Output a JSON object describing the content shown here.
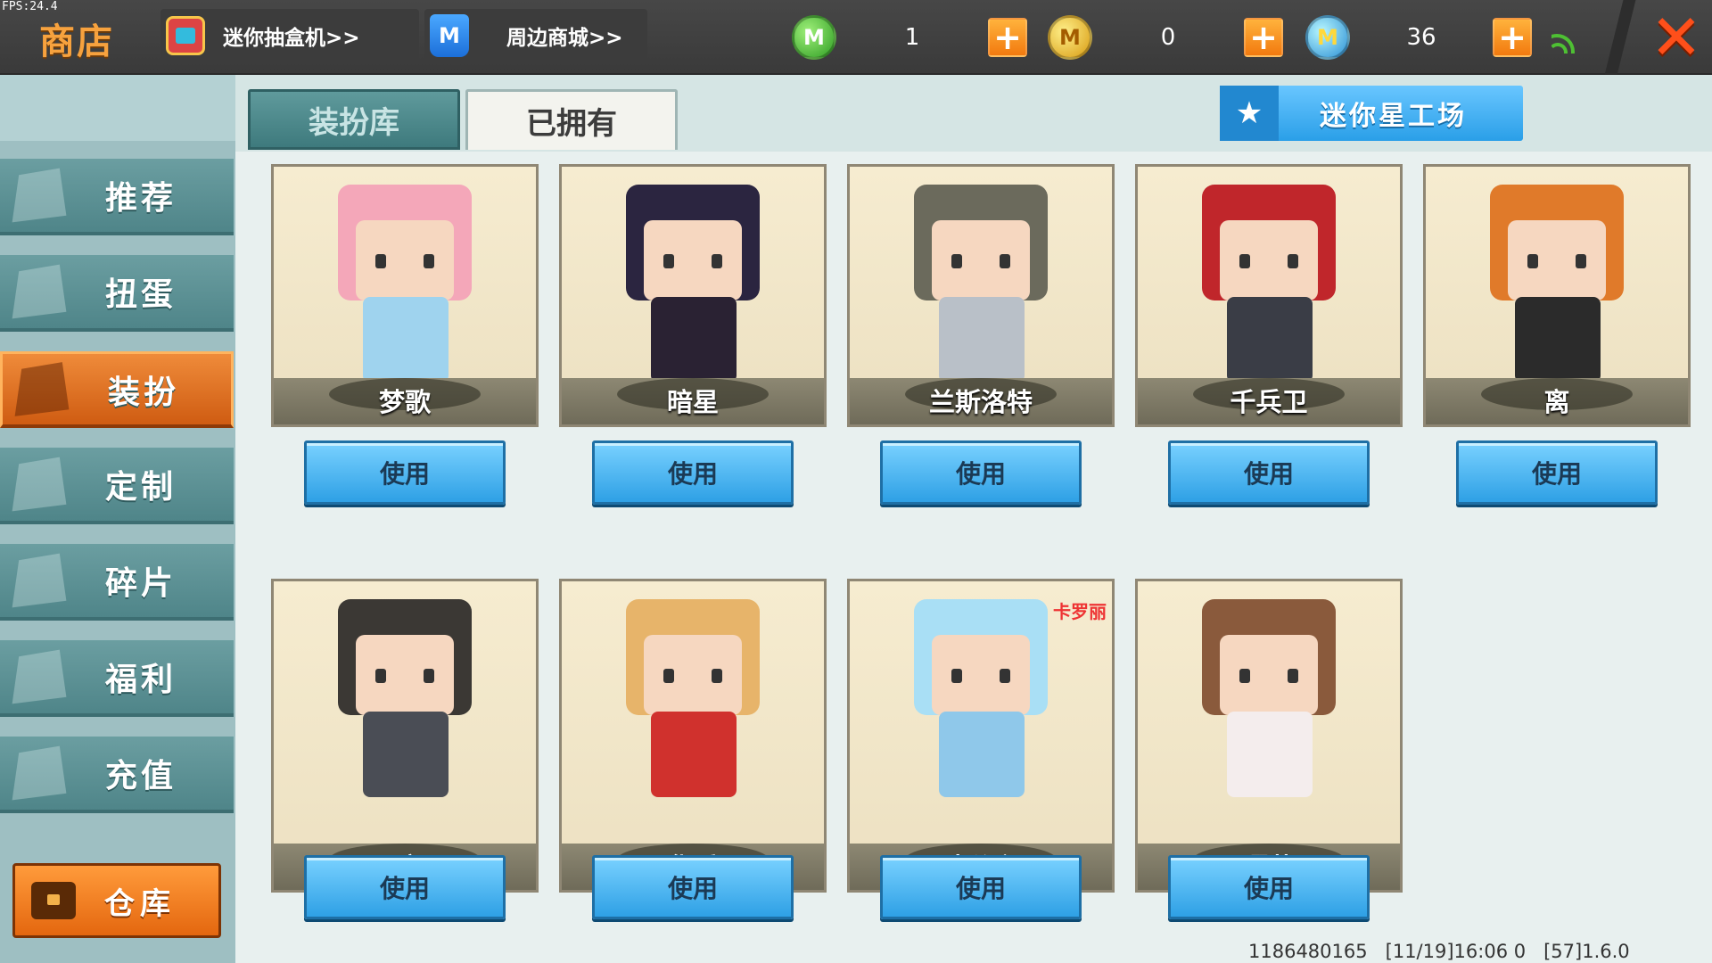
{
  "fps": "FPS:24.4",
  "header": {
    "title": "商店",
    "links": [
      {
        "label": "迷你抽盒机>>",
        "icon": "gacha-machine-icon"
      },
      {
        "label": "周边商城>>",
        "icon": "shopping-bag-icon"
      }
    ],
    "currencies": [
      {
        "icon": "mini-coin-green-icon",
        "value": "1"
      },
      {
        "icon": "gold-coin-icon",
        "value": "0"
      },
      {
        "icon": "mini-bean-blue-icon",
        "value": "36"
      }
    ],
    "close_icon": "close-icon",
    "signal_icon": "wifi-signal-icon"
  },
  "sidebar": {
    "items": [
      {
        "label": "推荐",
        "icon": "thumbs-up-icon",
        "active": false
      },
      {
        "label": "扭蛋",
        "icon": "gashapon-icon",
        "active": false
      },
      {
        "label": "装扮",
        "icon": "shirt-icon",
        "active": true
      },
      {
        "label": "定制",
        "icon": "pencil-icon",
        "active": false
      },
      {
        "label": "碎片",
        "icon": "puzzle-piece-icon",
        "active": false
      },
      {
        "label": "福利",
        "icon": "gift-icon",
        "active": false
      },
      {
        "label": "充值",
        "icon": "coins-icon",
        "active": false
      }
    ],
    "warehouse": {
      "label": "仓库",
      "icon": "treasure-chest-icon"
    }
  },
  "tabs": [
    {
      "label": "装扮库",
      "active": false
    },
    {
      "label": "已拥有",
      "active": true
    }
  ],
  "workshop_button": {
    "label": "迷你星工场",
    "icon": "star-badge-icon"
  },
  "skins": [
    {
      "name": "梦歌",
      "button": "使用",
      "hair": "#f4a7b9",
      "body": "#9fd3ee"
    },
    {
      "name": "暗星",
      "button": "使用",
      "hair": "#2b2540",
      "body": "#2a2233"
    },
    {
      "name": "兰斯洛特",
      "button": "使用",
      "hair": "#6b6a5c",
      "body": "#b9c0c8"
    },
    {
      "name": "千兵卫",
      "button": "使用",
      "hair": "#c0262b",
      "body": "#3a3d46"
    },
    {
      "name": "离",
      "button": "使用",
      "hair": "#e07a2a",
      "body": "#2b2b2b"
    },
    {
      "name": "黯",
      "button": "使用",
      "hair": "#3b3834",
      "body": "#4a4d55"
    },
    {
      "name": "华乐",
      "button": "使用",
      "hair": "#e7b46a",
      "body": "#d0312d"
    },
    {
      "name": "冰公主",
      "button": "使用",
      "hair": "#a9dff5",
      "body": "#8fc8ea",
      "tag": "卡罗丽"
    },
    {
      "name": "璎落",
      "button": "使用",
      "hair": "#8a5a3c",
      "body": "#f4eded"
    }
  ],
  "footer": {
    "info": "1186480165   [11/19]16:06 0   [57]1.6.0"
  }
}
